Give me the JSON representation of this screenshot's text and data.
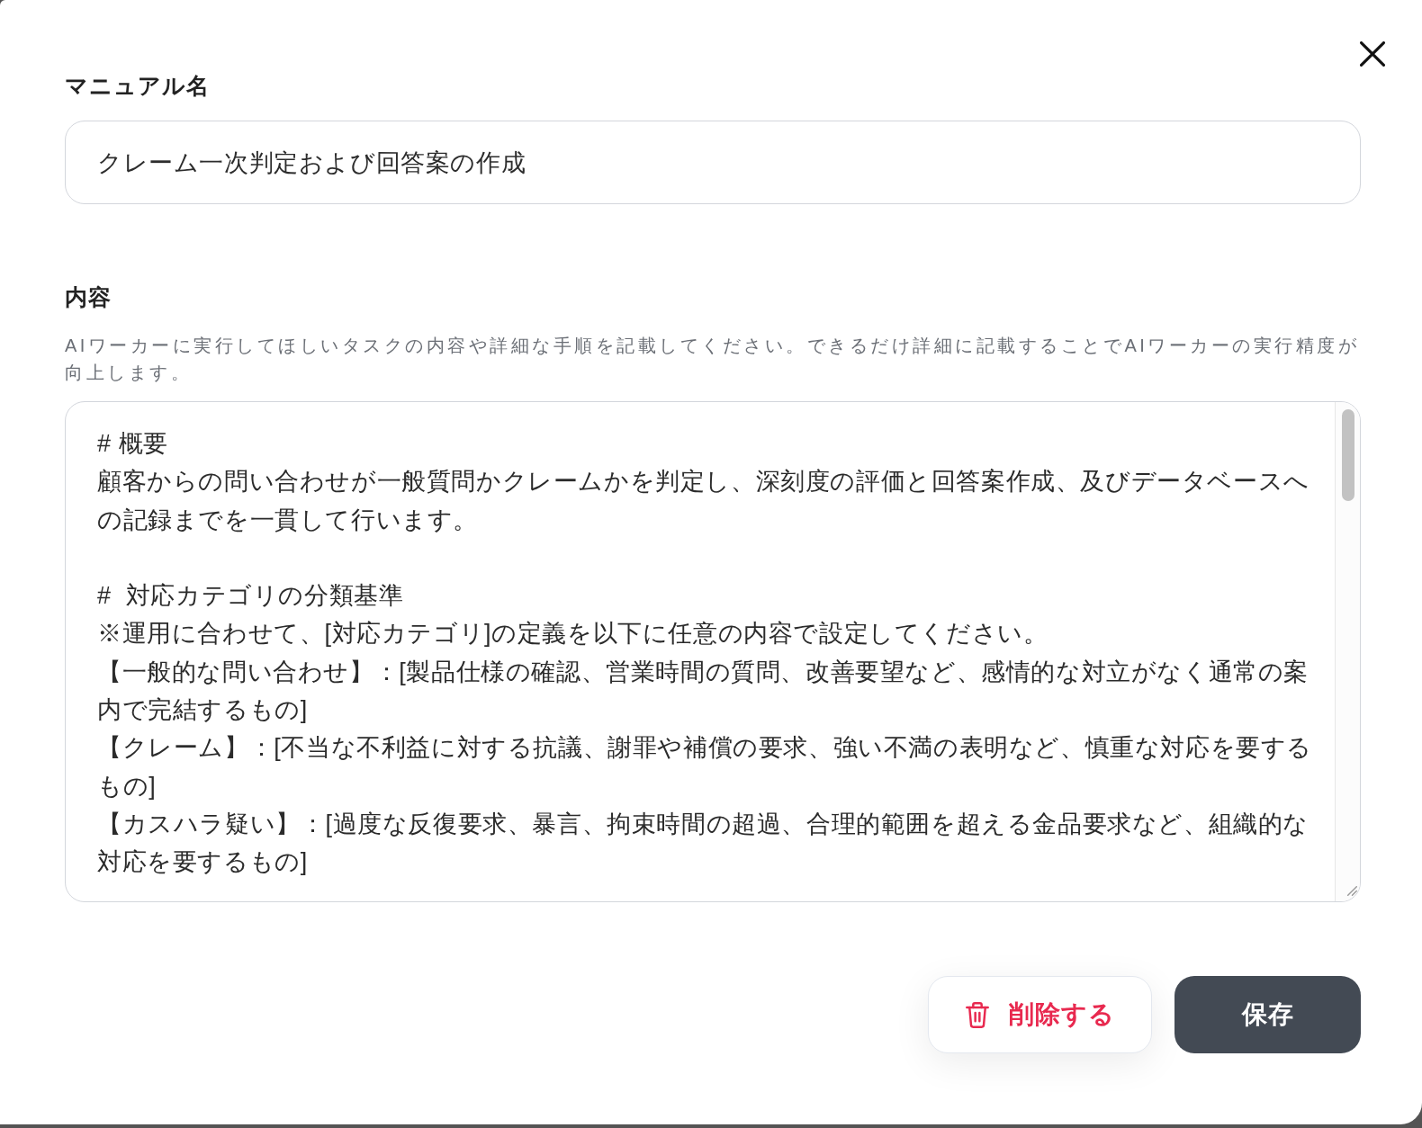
{
  "fields": [
    {
      "kind": "input",
      "label": "マニュアル名",
      "value": "クレーム一次判定および回答案の作成"
    },
    {
      "kind": "textarea",
      "label": "内容",
      "description": "AIワーカーに実行してほしいタスクの内容や詳細な手順を記載してください。できるだけ詳細に記載することでAIワーカーの実行精度が向上します。",
      "paragraphs": [
        [
          "# 概要",
          "顧客からの問い合わせが一般質問かクレームかを判定し、深刻度の評価と回答案作成、及びデータベースへの記録までを一貫して行います。"
        ],
        [
          "#  対応カテゴリの分類基準",
          "※運用に合わせて、[対応カテゴリ]の定義を以下に任意の内容で設定してください。",
          "【一般的な問い合わせ】：[製品仕様の確認、営業時間の質問、改善要望など、感情的な対立がなく通常の案内で完結するもの]",
          "【クレーム】：[不当な不利益に対する抗議、謝罪や補償の要求、強い不満の表明など、慎重な対応を要するもの]",
          "【カスハラ疑い】：[過度な反復要求、暴言、拘束時間の超過、合理的範囲を超える金品要求など、組織的な対応を要するもの]"
        ]
      ]
    }
  ],
  "actions": [
    {
      "kind": "danger",
      "label": "削除する"
    },
    {
      "kind": "primary",
      "label": "保存"
    }
  ]
}
